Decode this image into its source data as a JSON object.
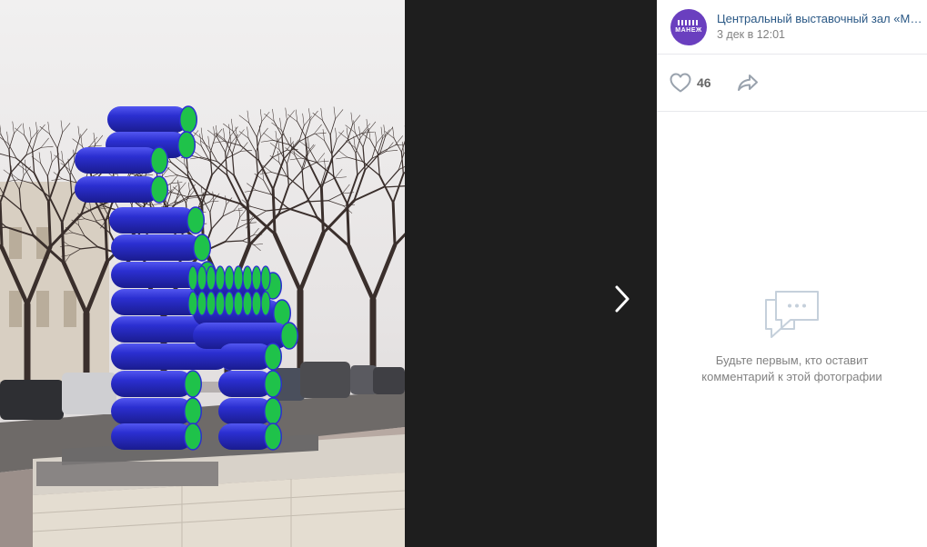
{
  "post": {
    "author_name": "Центральный выставочный зал «Манеж»",
    "avatar_text": "МАНЕЖ",
    "date": "3 дек в 12:01"
  },
  "actions": {
    "likes_count": "46"
  },
  "comments": {
    "empty_line1": "Будьте первым, кто оставит",
    "empty_line2": "комментарий к этой фотографии"
  },
  "colors": {
    "link": "#2a5885",
    "avatar_bg": "#6a3fbf",
    "sculpture_blue": "#2b2fd1",
    "sculpture_green": "#1fc24a"
  },
  "icons": {
    "like": "heart-icon",
    "share": "share-arrow-icon",
    "next": "chevron-right-icon",
    "empty_comments": "chat-bubbles-icon"
  }
}
